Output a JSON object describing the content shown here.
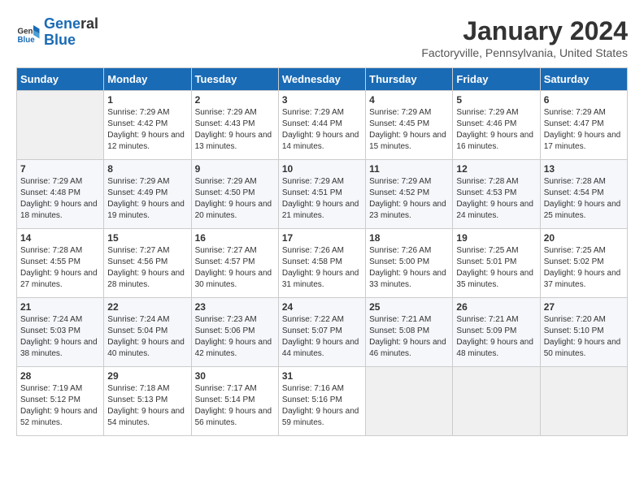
{
  "header": {
    "logo_line1": "General",
    "logo_line2": "Blue",
    "month_title": "January 2024",
    "location": "Factoryville, Pennsylvania, United States"
  },
  "days_of_week": [
    "Sunday",
    "Monday",
    "Tuesday",
    "Wednesday",
    "Thursday",
    "Friday",
    "Saturday"
  ],
  "weeks": [
    [
      {
        "num": "",
        "empty": true
      },
      {
        "num": "1",
        "rise": "7:29 AM",
        "set": "4:42 PM",
        "daylight": "9 hours and 12 minutes."
      },
      {
        "num": "2",
        "rise": "7:29 AM",
        "set": "4:43 PM",
        "daylight": "9 hours and 13 minutes."
      },
      {
        "num": "3",
        "rise": "7:29 AM",
        "set": "4:44 PM",
        "daylight": "9 hours and 14 minutes."
      },
      {
        "num": "4",
        "rise": "7:29 AM",
        "set": "4:45 PM",
        "daylight": "9 hours and 15 minutes."
      },
      {
        "num": "5",
        "rise": "7:29 AM",
        "set": "4:46 PM",
        "daylight": "9 hours and 16 minutes."
      },
      {
        "num": "6",
        "rise": "7:29 AM",
        "set": "4:47 PM",
        "daylight": "9 hours and 17 minutes."
      }
    ],
    [
      {
        "num": "7",
        "rise": "7:29 AM",
        "set": "4:48 PM",
        "daylight": "9 hours and 18 minutes."
      },
      {
        "num": "8",
        "rise": "7:29 AM",
        "set": "4:49 PM",
        "daylight": "9 hours and 19 minutes."
      },
      {
        "num": "9",
        "rise": "7:29 AM",
        "set": "4:50 PM",
        "daylight": "9 hours and 20 minutes."
      },
      {
        "num": "10",
        "rise": "7:29 AM",
        "set": "4:51 PM",
        "daylight": "9 hours and 21 minutes."
      },
      {
        "num": "11",
        "rise": "7:29 AM",
        "set": "4:52 PM",
        "daylight": "9 hours and 23 minutes."
      },
      {
        "num": "12",
        "rise": "7:28 AM",
        "set": "4:53 PM",
        "daylight": "9 hours and 24 minutes."
      },
      {
        "num": "13",
        "rise": "7:28 AM",
        "set": "4:54 PM",
        "daylight": "9 hours and 25 minutes."
      }
    ],
    [
      {
        "num": "14",
        "rise": "7:28 AM",
        "set": "4:55 PM",
        "daylight": "9 hours and 27 minutes."
      },
      {
        "num": "15",
        "rise": "7:27 AM",
        "set": "4:56 PM",
        "daylight": "9 hours and 28 minutes."
      },
      {
        "num": "16",
        "rise": "7:27 AM",
        "set": "4:57 PM",
        "daylight": "9 hours and 30 minutes."
      },
      {
        "num": "17",
        "rise": "7:26 AM",
        "set": "4:58 PM",
        "daylight": "9 hours and 31 minutes."
      },
      {
        "num": "18",
        "rise": "7:26 AM",
        "set": "5:00 PM",
        "daylight": "9 hours and 33 minutes."
      },
      {
        "num": "19",
        "rise": "7:25 AM",
        "set": "5:01 PM",
        "daylight": "9 hours and 35 minutes."
      },
      {
        "num": "20",
        "rise": "7:25 AM",
        "set": "5:02 PM",
        "daylight": "9 hours and 37 minutes."
      }
    ],
    [
      {
        "num": "21",
        "rise": "7:24 AM",
        "set": "5:03 PM",
        "daylight": "9 hours and 38 minutes."
      },
      {
        "num": "22",
        "rise": "7:24 AM",
        "set": "5:04 PM",
        "daylight": "9 hours and 40 minutes."
      },
      {
        "num": "23",
        "rise": "7:23 AM",
        "set": "5:06 PM",
        "daylight": "9 hours and 42 minutes."
      },
      {
        "num": "24",
        "rise": "7:22 AM",
        "set": "5:07 PM",
        "daylight": "9 hours and 44 minutes."
      },
      {
        "num": "25",
        "rise": "7:21 AM",
        "set": "5:08 PM",
        "daylight": "9 hours and 46 minutes."
      },
      {
        "num": "26",
        "rise": "7:21 AM",
        "set": "5:09 PM",
        "daylight": "9 hours and 48 minutes."
      },
      {
        "num": "27",
        "rise": "7:20 AM",
        "set": "5:10 PM",
        "daylight": "9 hours and 50 minutes."
      }
    ],
    [
      {
        "num": "28",
        "rise": "7:19 AM",
        "set": "5:12 PM",
        "daylight": "9 hours and 52 minutes."
      },
      {
        "num": "29",
        "rise": "7:18 AM",
        "set": "5:13 PM",
        "daylight": "9 hours and 54 minutes."
      },
      {
        "num": "30",
        "rise": "7:17 AM",
        "set": "5:14 PM",
        "daylight": "9 hours and 56 minutes."
      },
      {
        "num": "31",
        "rise": "7:16 AM",
        "set": "5:16 PM",
        "daylight": "9 hours and 59 minutes."
      },
      {
        "num": "",
        "empty": true
      },
      {
        "num": "",
        "empty": true
      },
      {
        "num": "",
        "empty": true
      }
    ]
  ],
  "labels": {
    "sunrise": "Sunrise:",
    "sunset": "Sunset:",
    "daylight": "Daylight:"
  }
}
